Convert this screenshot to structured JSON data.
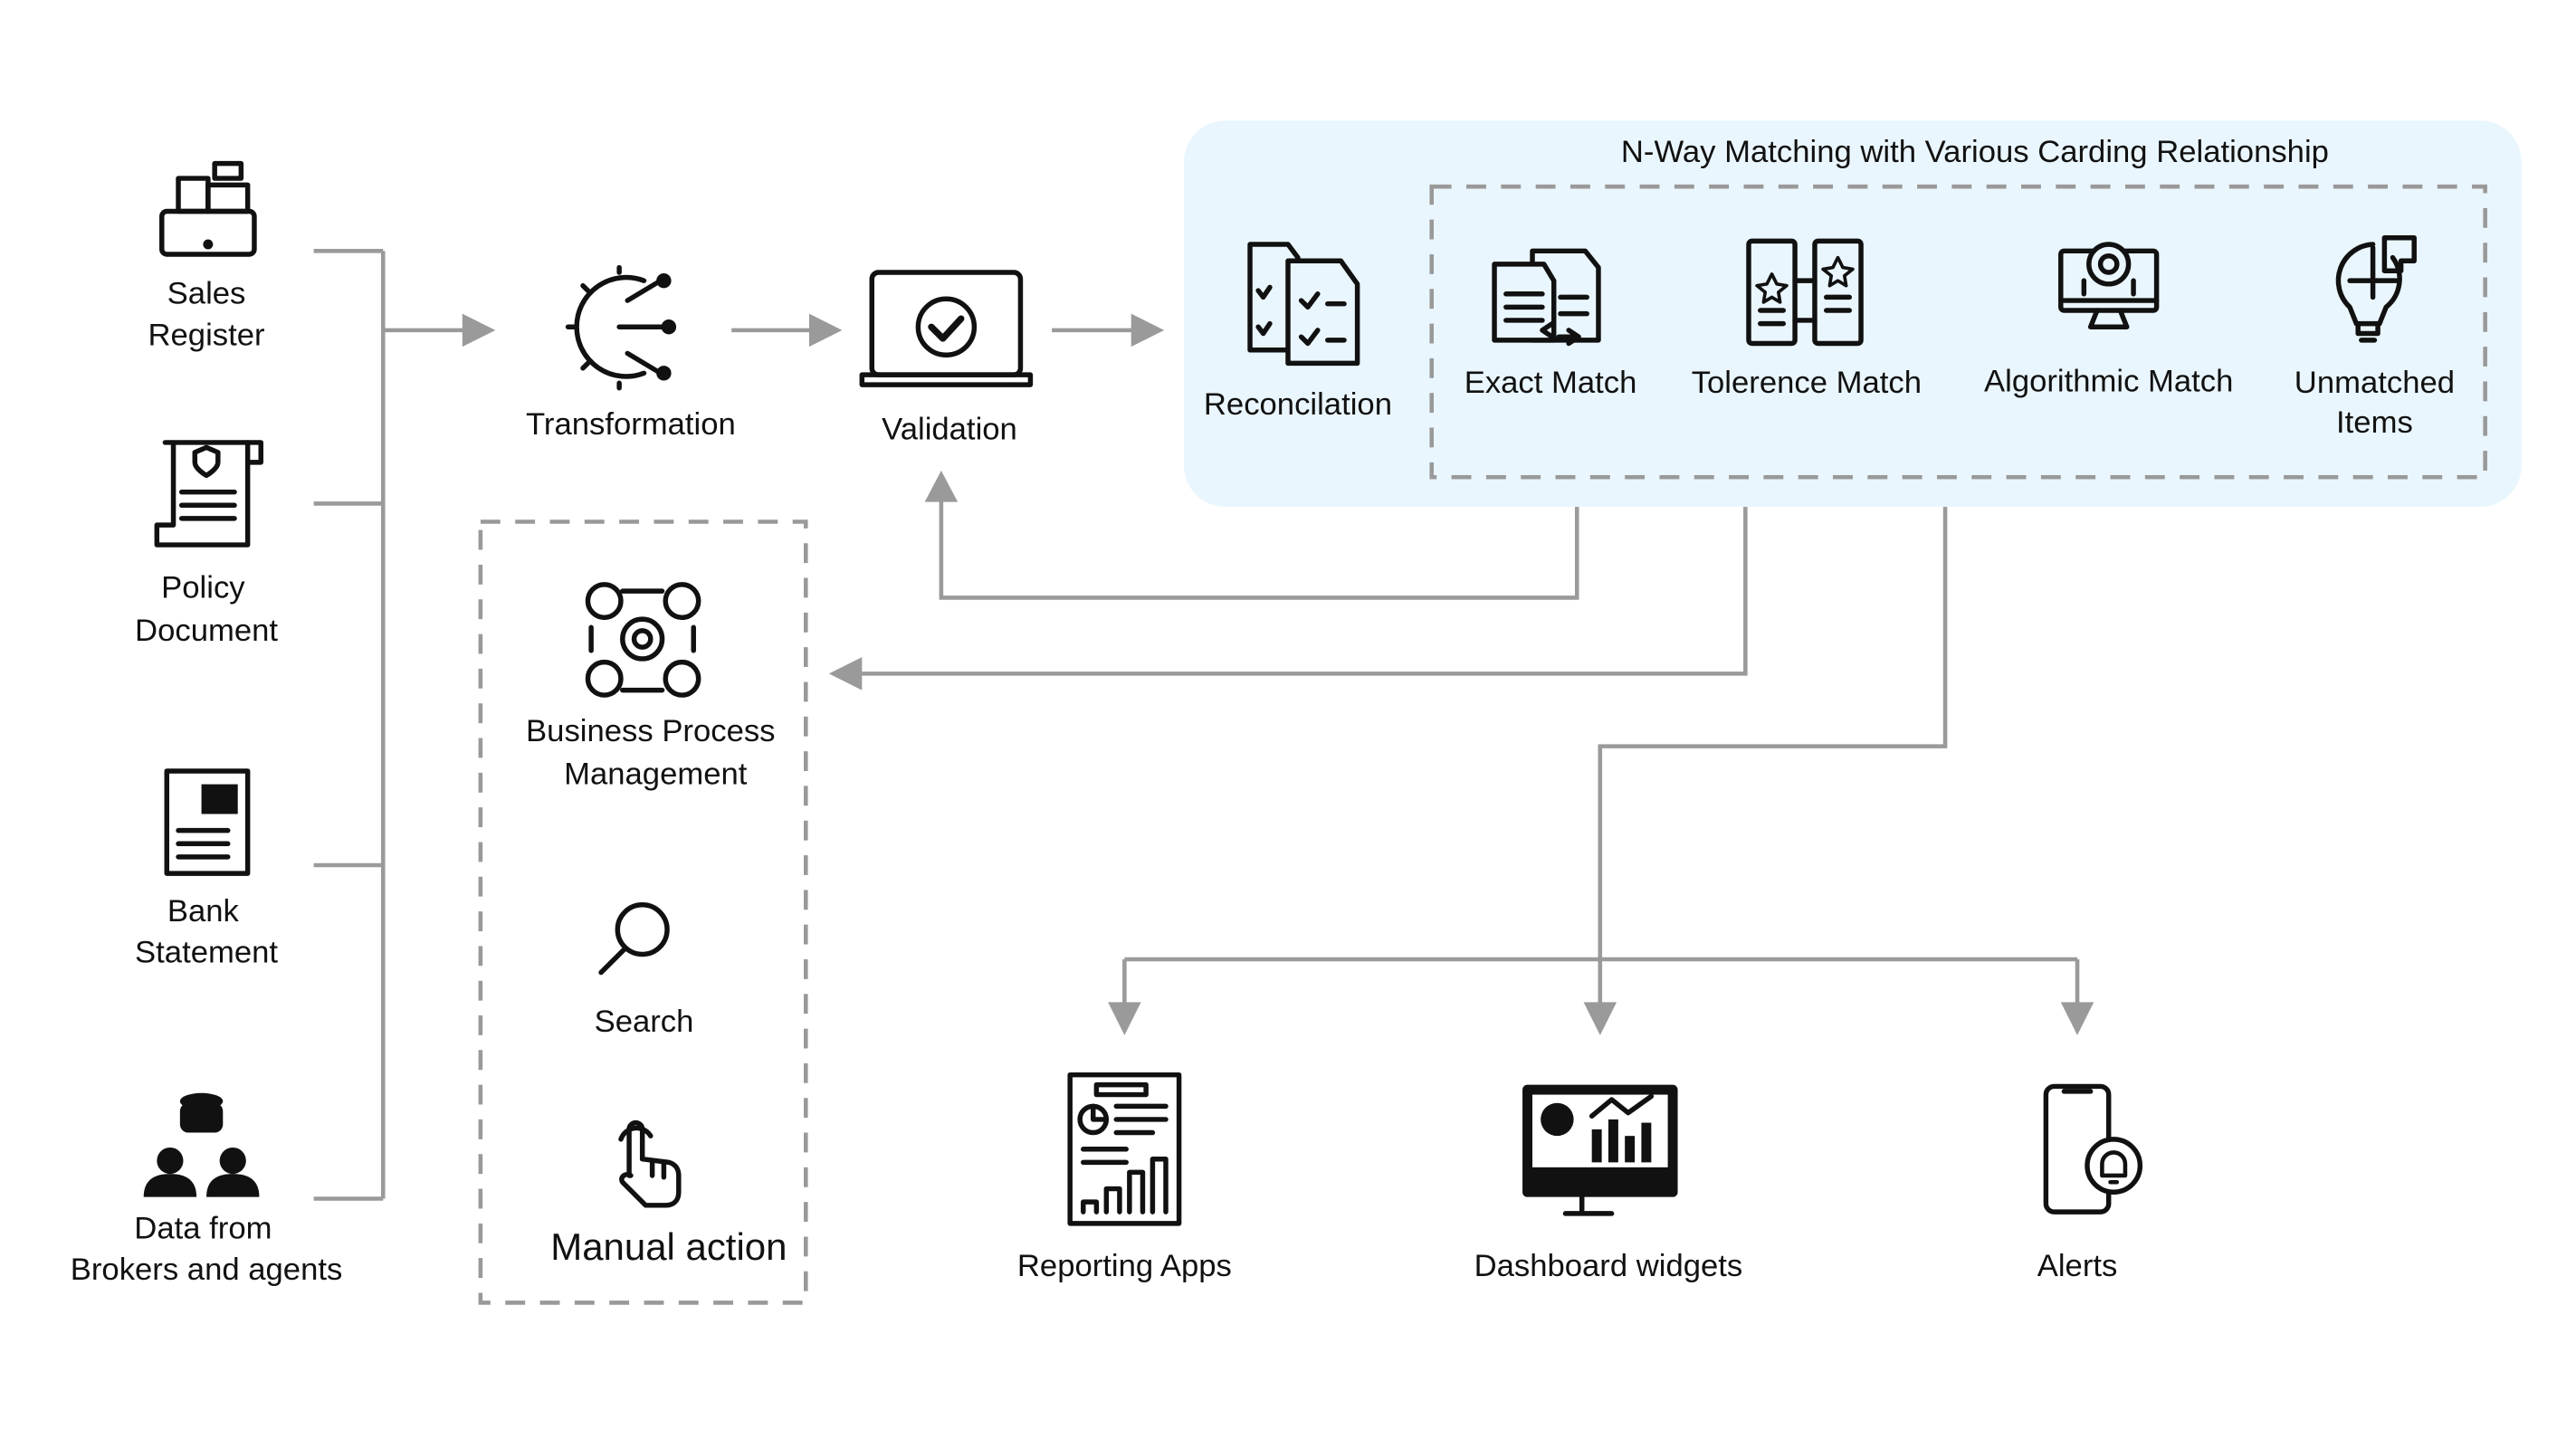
{
  "sources": [
    {
      "line1": "Sales",
      "line2": "Register",
      "icon": "cash-register-icon"
    },
    {
      "line1": "Policy",
      "line2": "Document",
      "icon": "policy-document-icon"
    },
    {
      "line1": "Bank",
      "line2": "Statement",
      "icon": "bank-statement-icon"
    },
    {
      "line1": "Data from",
      "line2": "Brokers and agents",
      "icon": "database-people-icon"
    }
  ],
  "flow": {
    "transformation": "Transformation",
    "validation": "Validation",
    "reconciliation": "Reconcilation"
  },
  "matching": {
    "title": "N-Way Matching with Various Carding Relationship",
    "items": [
      {
        "label": "Exact Match",
        "icon": "exact-match-icon"
      },
      {
        "label": "Tolerence Match",
        "icon": "tolerance-match-icon"
      },
      {
        "label": "Algorithmic Match",
        "icon": "algorithm-gear-monitor-icon"
      },
      {
        "line1": "Unmatched",
        "line2": "Items",
        "icon": "puzzle-bulb-icon"
      }
    ],
    "background": "#eaf6fd"
  },
  "manual": {
    "bpm_line1": "Business Process",
    "bpm_line2": "Management",
    "search": "Search",
    "manual_action": "Manual action"
  },
  "outputs": [
    {
      "label": "Reporting Apps",
      "icon": "report-icon"
    },
    {
      "label": "Dashboard widgets",
      "icon": "dashboard-monitor-icon"
    },
    {
      "label": "Alerts",
      "icon": "phone-bell-icon"
    }
  ],
  "connector_color": "#9a9a9a"
}
